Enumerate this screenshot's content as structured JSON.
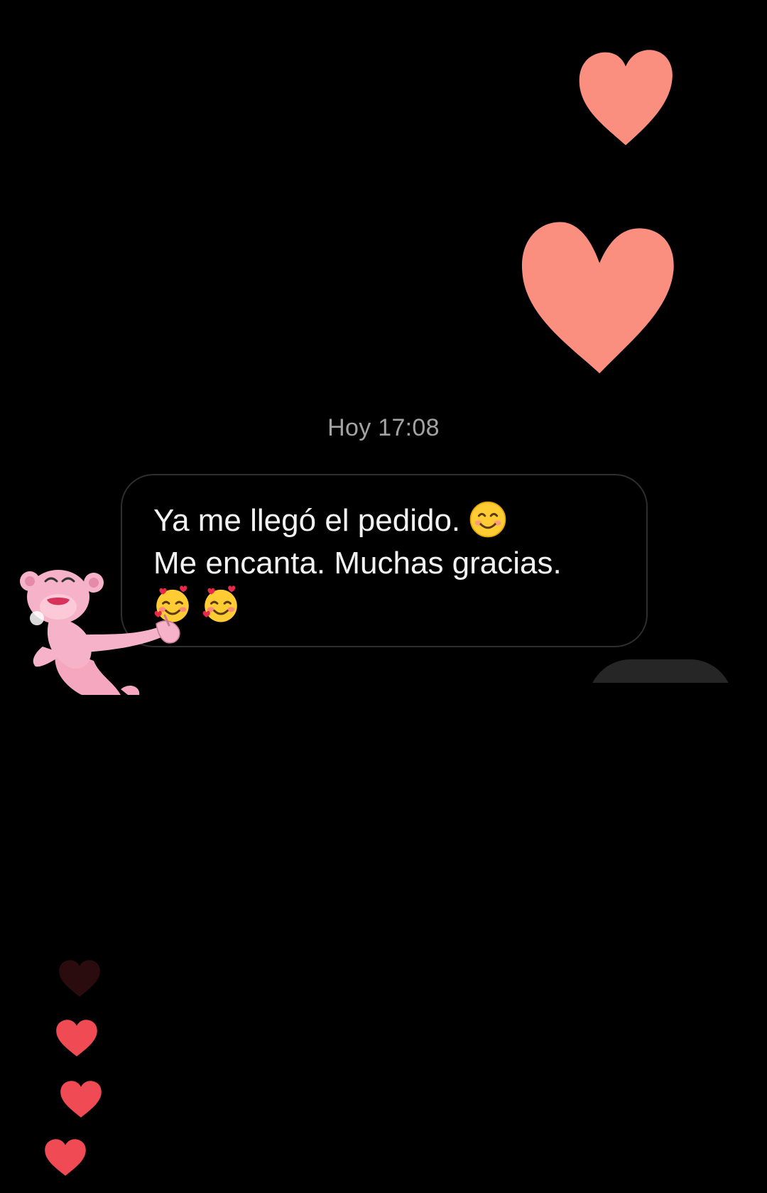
{
  "conversation": {
    "date_label": "Hoy 17:08",
    "message": {
      "line1": "Ya me llegó el pedido.",
      "line2": "Me encanta. Muchas gracias.",
      "emoji_line1": "smiling-face-with-smiling-eyes",
      "emoji_line3": [
        "smiling-face-with-hearts",
        "smiling-face-with-hearts"
      ]
    }
  },
  "decorations": {
    "large_hearts_color": "#fa8f80",
    "small_hearts_color": "#f04a55",
    "faded_heart_color": "#2a0c0e",
    "character": "pink-panther-sticker"
  },
  "colors": {
    "background": "#000000",
    "bubble_border": "#2e2e2e",
    "message_text": "#f2f2f2",
    "date_text": "#a3a3a3"
  }
}
